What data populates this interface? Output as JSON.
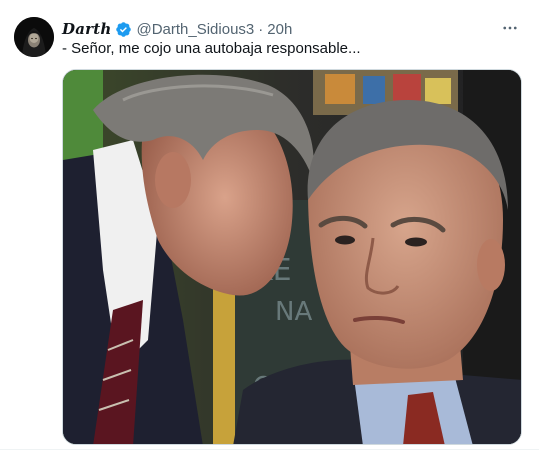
{
  "tweet": {
    "display_name": "Darth",
    "handle": "@Darth_Sidious3",
    "separator": "·",
    "time": "20h",
    "text": "- Señor, me cojo una autobaja responsable...",
    "more_icon": "more-horizontal-icon",
    "verified_icon": "verified-badge-icon",
    "verified_color": "#1d9bf0",
    "media": {
      "description_icon": "photo",
      "sign_letters": [
        "KE",
        "NA",
        "CO"
      ]
    }
  }
}
